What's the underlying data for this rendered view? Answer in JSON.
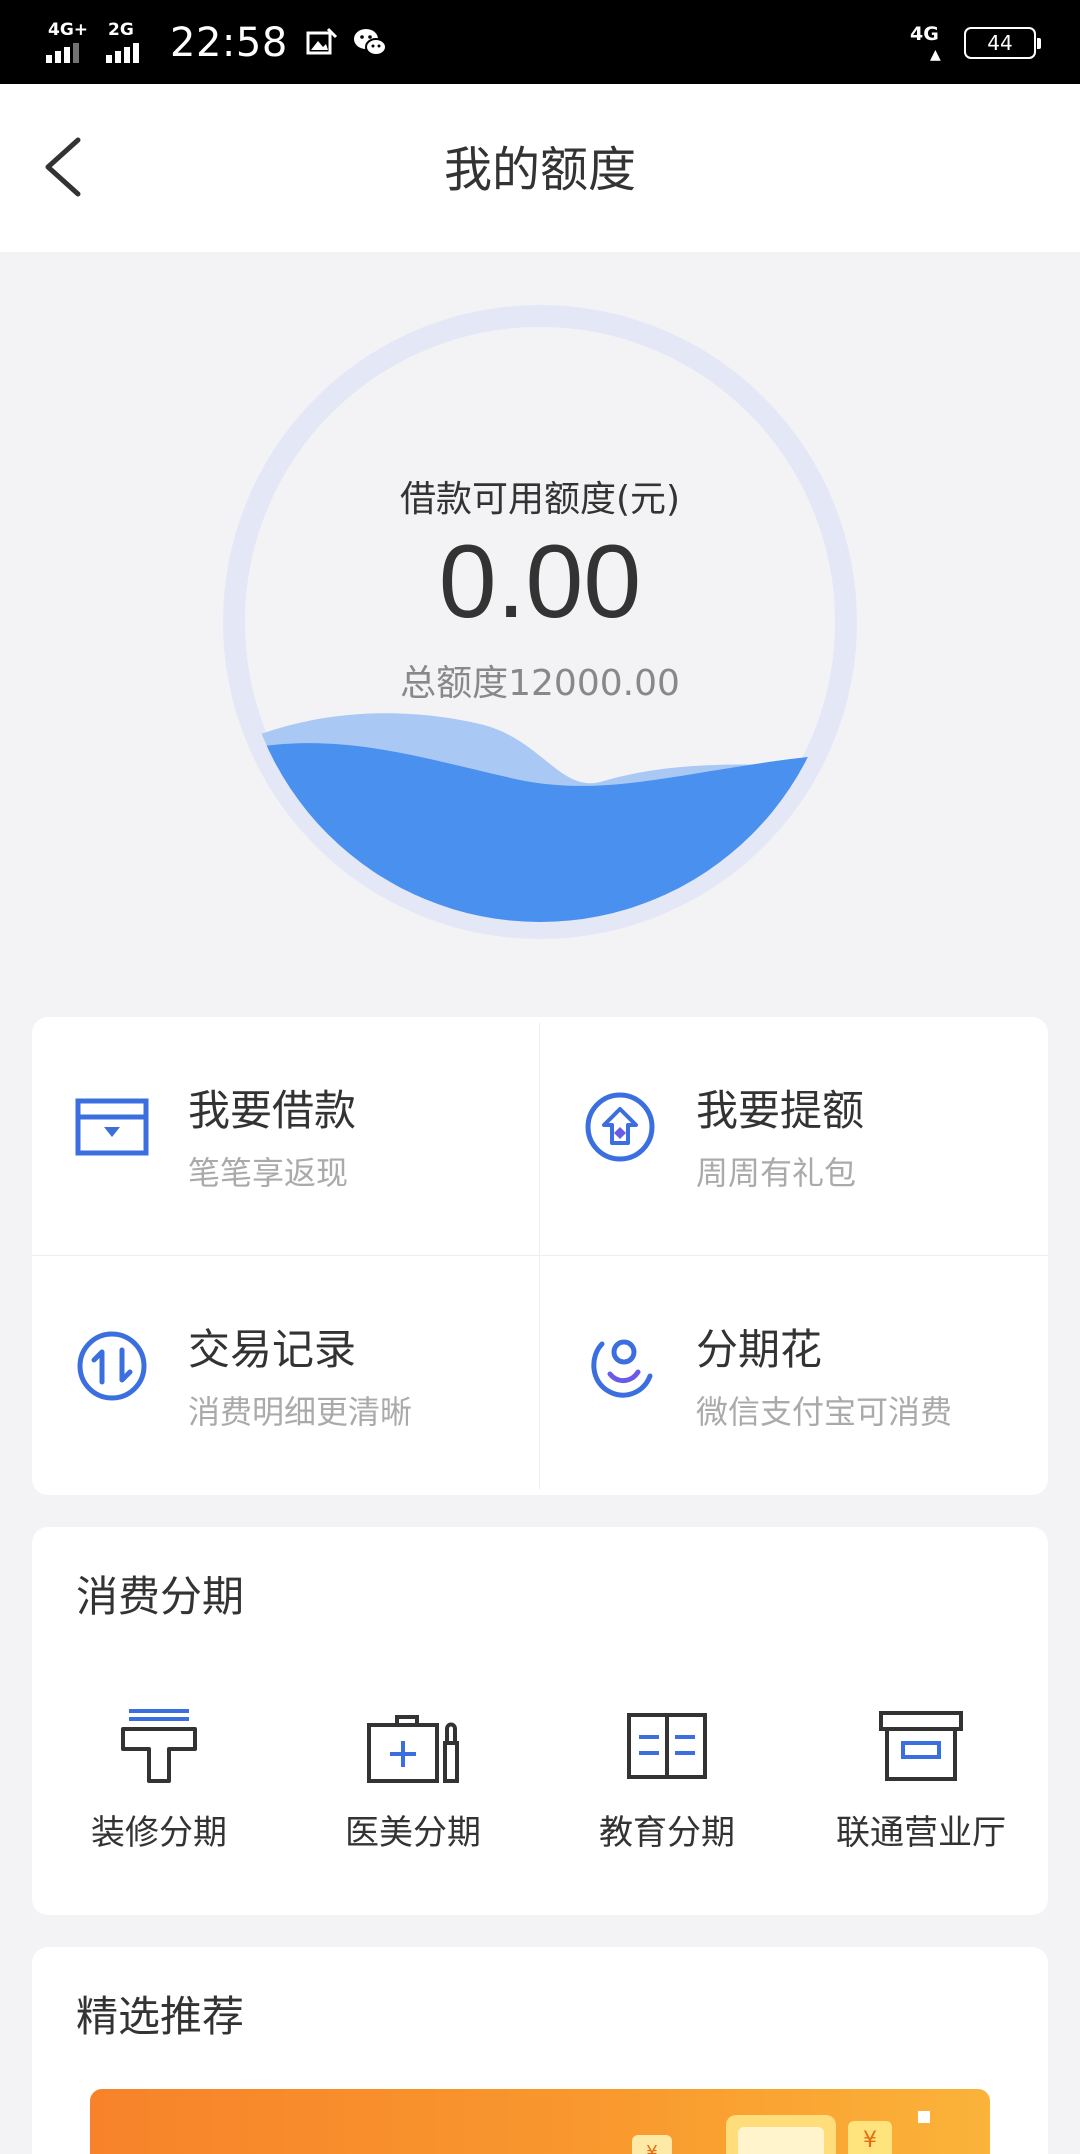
{
  "status_bar": {
    "net1": "4G+",
    "net2": "2G",
    "time": "22:58",
    "net_right": "4G",
    "battery": "44",
    "icons": [
      "signal-icon",
      "photo-icon",
      "wechat-icon",
      "battery-icon"
    ]
  },
  "nav": {
    "title": "我的额度",
    "back_icon": "chevron-left-icon"
  },
  "gauge": {
    "label": "借款可用额度(元)",
    "amount": "0.00",
    "total": "总额度12000.00",
    "colors": {
      "ring": "#e4e8f6",
      "wave_front": "#4a90ee",
      "wave_back": "#a9c9f4"
    }
  },
  "quick_actions": [
    {
      "title": "我要借款",
      "subtitle": "笔笔享返现",
      "icon": "loan-card-icon"
    },
    {
      "title": "我要提额",
      "subtitle": "周周有礼包",
      "icon": "raise-limit-icon"
    },
    {
      "title": "交易记录",
      "subtitle": "消费明细更清晰",
      "icon": "transfer-icon"
    },
    {
      "title": "分期花",
      "subtitle": "微信支付宝可消费",
      "icon": "smile-icon"
    }
  ],
  "installments": {
    "title": "消费分期",
    "items": [
      {
        "label": "装修分期",
        "icon": "paint-roller-icon"
      },
      {
        "label": "医美分期",
        "icon": "medical-kit-icon"
      },
      {
        "label": "教育分期",
        "icon": "book-icon"
      },
      {
        "label": "联通营业厅",
        "icon": "storefront-icon"
      }
    ]
  },
  "recommend": {
    "title": "精选推荐",
    "banner_coin": "¥"
  },
  "accent_color": "#3b6fe0"
}
